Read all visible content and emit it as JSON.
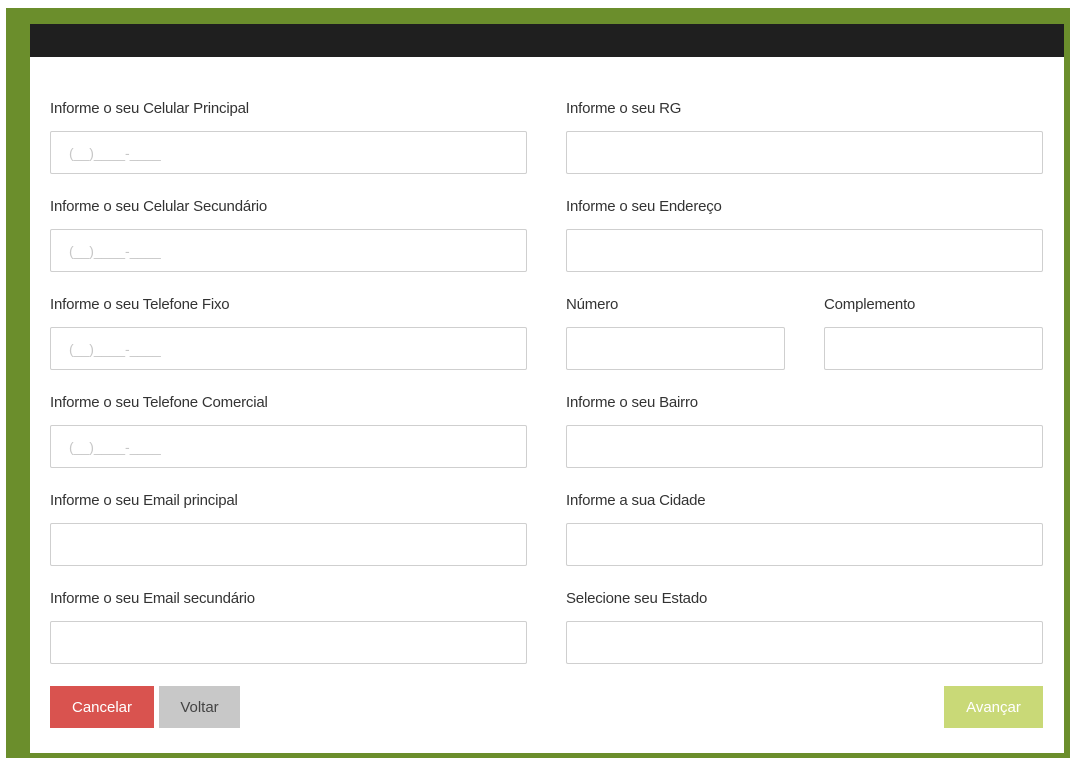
{
  "form": {
    "left": [
      {
        "label": "Informe o seu Celular Principal",
        "placeholder": "(__)____-____",
        "value": ""
      },
      {
        "label": "Informe o seu Celular Secundário",
        "placeholder": "(__)____-____",
        "value": ""
      },
      {
        "label": "Informe o seu Telefone Fixo",
        "placeholder": "(__)____-____",
        "value": ""
      },
      {
        "label": "Informe o seu Telefone Comercial",
        "placeholder": "(__)____-____",
        "value": ""
      },
      {
        "label": "Informe o seu Email principal",
        "placeholder": "",
        "value": ""
      },
      {
        "label": "Informe o seu Email secundário",
        "placeholder": "",
        "value": ""
      }
    ],
    "right": {
      "rg": {
        "label": "Informe o seu RG",
        "value": ""
      },
      "endereco": {
        "label": "Informe o seu Endereço",
        "value": ""
      },
      "numero": {
        "label": "Número",
        "value": ""
      },
      "complemento": {
        "label": "Complemento",
        "value": ""
      },
      "bairro": {
        "label": "Informe o seu Bairro",
        "value": ""
      },
      "cidade": {
        "label": "Informe a sua Cidade",
        "value": ""
      },
      "estado": {
        "label": "Selecione seu Estado",
        "value": ""
      }
    }
  },
  "buttons": {
    "cancel": "Cancelar",
    "back": "Voltar",
    "next": "Avançar"
  },
  "colors": {
    "frame": "#6b8e2c",
    "topbar": "#1f1f1f",
    "cancel": "#d9534f",
    "back": "#c8c8c8",
    "next": "#c9d977"
  }
}
